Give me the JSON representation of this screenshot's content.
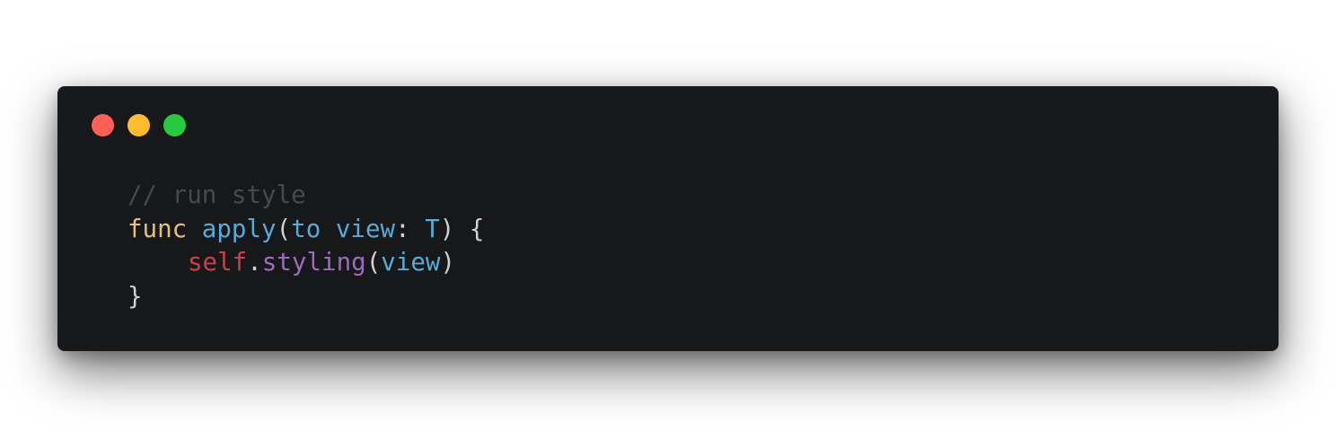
{
  "window": {
    "background": "#17181a",
    "traffic_lights": [
      {
        "name": "close",
        "color": "#ff5f57"
      },
      {
        "name": "minimize",
        "color": "#febc2e"
      },
      {
        "name": "zoom",
        "color": "#28c840"
      }
    ]
  },
  "code": {
    "colors": {
      "comment": "#424b50",
      "keyword": "#e5c07b",
      "function": "#5aa9d6",
      "plain": "#d0d0d0",
      "self": "#c8414b",
      "method": "#9b6bbf"
    },
    "lines": [
      {
        "tokens": [
          {
            "text": "// run style",
            "kind": "comment"
          }
        ]
      },
      {
        "tokens": [
          {
            "text": "func",
            "kind": "keyword"
          },
          {
            "text": " ",
            "kind": "plain"
          },
          {
            "text": "apply",
            "kind": "function"
          },
          {
            "text": "(",
            "kind": "plain"
          },
          {
            "text": "to",
            "kind": "function"
          },
          {
            "text": " ",
            "kind": "plain"
          },
          {
            "text": "view",
            "kind": "function"
          },
          {
            "text": ": ",
            "kind": "plain"
          },
          {
            "text": "T",
            "kind": "function"
          },
          {
            "text": ") {",
            "kind": "plain"
          }
        ]
      },
      {
        "indent": true,
        "tokens": [
          {
            "text": "self",
            "kind": "self"
          },
          {
            "text": ".",
            "kind": "plain"
          },
          {
            "text": "styling",
            "kind": "method"
          },
          {
            "text": "(",
            "kind": "plain"
          },
          {
            "text": "view",
            "kind": "function"
          },
          {
            "text": ")",
            "kind": "plain"
          }
        ]
      },
      {
        "tokens": [
          {
            "text": "}",
            "kind": "plain"
          }
        ]
      }
    ]
  }
}
